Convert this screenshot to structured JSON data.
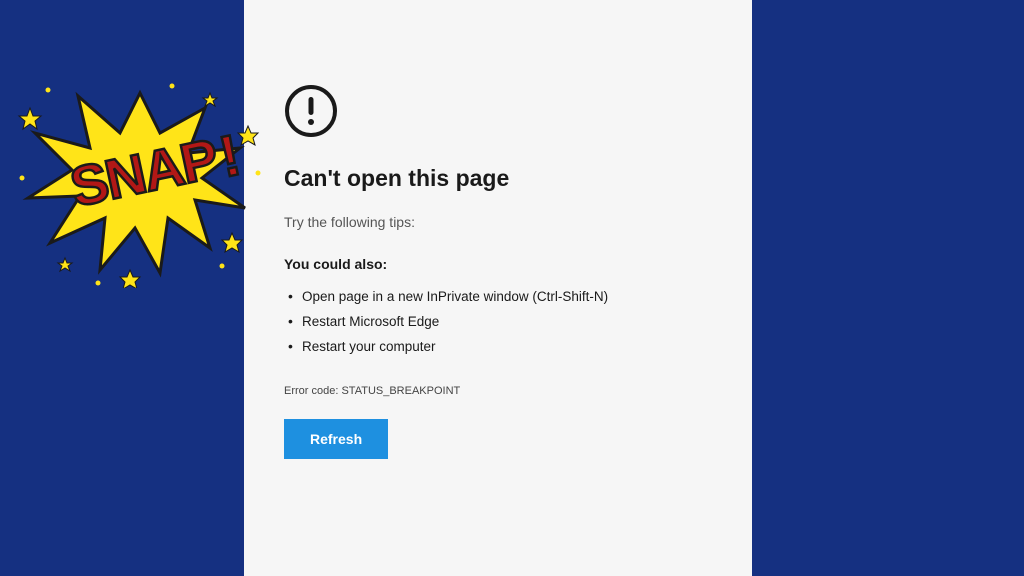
{
  "error": {
    "title": "Can't open this page",
    "subtitle": "Try the following tips:",
    "secondary_title": "You could also:",
    "tips": [
      "Open page in a new InPrivate window (Ctrl-Shift-N)",
      "Restart Microsoft Edge",
      "Restart your computer"
    ],
    "error_code": "Error code: STATUS_BREAKPOINT",
    "refresh_label": "Refresh"
  },
  "decoration": {
    "snap_text": "SNAP!"
  }
}
